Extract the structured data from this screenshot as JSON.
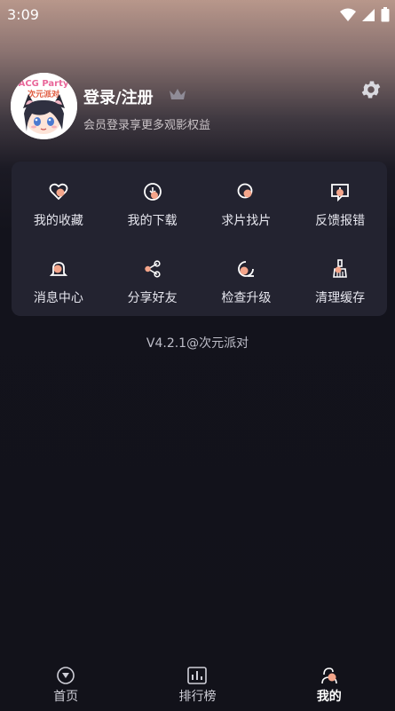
{
  "status_bar": {
    "time": "3:09"
  },
  "profile": {
    "title": "登录/注册",
    "subtitle": "会员登录享更多观影权益",
    "avatar_text": "ACG Party 次元派对"
  },
  "menu": {
    "items": [
      {
        "label": "我的收藏",
        "icon": "heart-icon"
      },
      {
        "label": "我的下载",
        "icon": "download-icon"
      },
      {
        "label": "求片找片",
        "icon": "search-film-icon"
      },
      {
        "label": "反馈报错",
        "icon": "feedback-icon"
      },
      {
        "label": "消息中心",
        "icon": "bell-icon"
      },
      {
        "label": "分享好友",
        "icon": "share-icon"
      },
      {
        "label": "检查升级",
        "icon": "upgrade-icon"
      },
      {
        "label": "清理缓存",
        "icon": "broom-icon"
      }
    ]
  },
  "footer": {
    "version": "V4.2.1@次元派对"
  },
  "bottom_nav": {
    "items": [
      {
        "label": "首页",
        "icon": "home-icon"
      },
      {
        "label": "排行榜",
        "icon": "ranking-icon"
      },
      {
        "label": "我的",
        "icon": "profile-icon",
        "active": true
      }
    ]
  },
  "colors": {
    "accent": "#f4a58a",
    "card_bg": "#232330",
    "page_bg": "#12121a"
  }
}
